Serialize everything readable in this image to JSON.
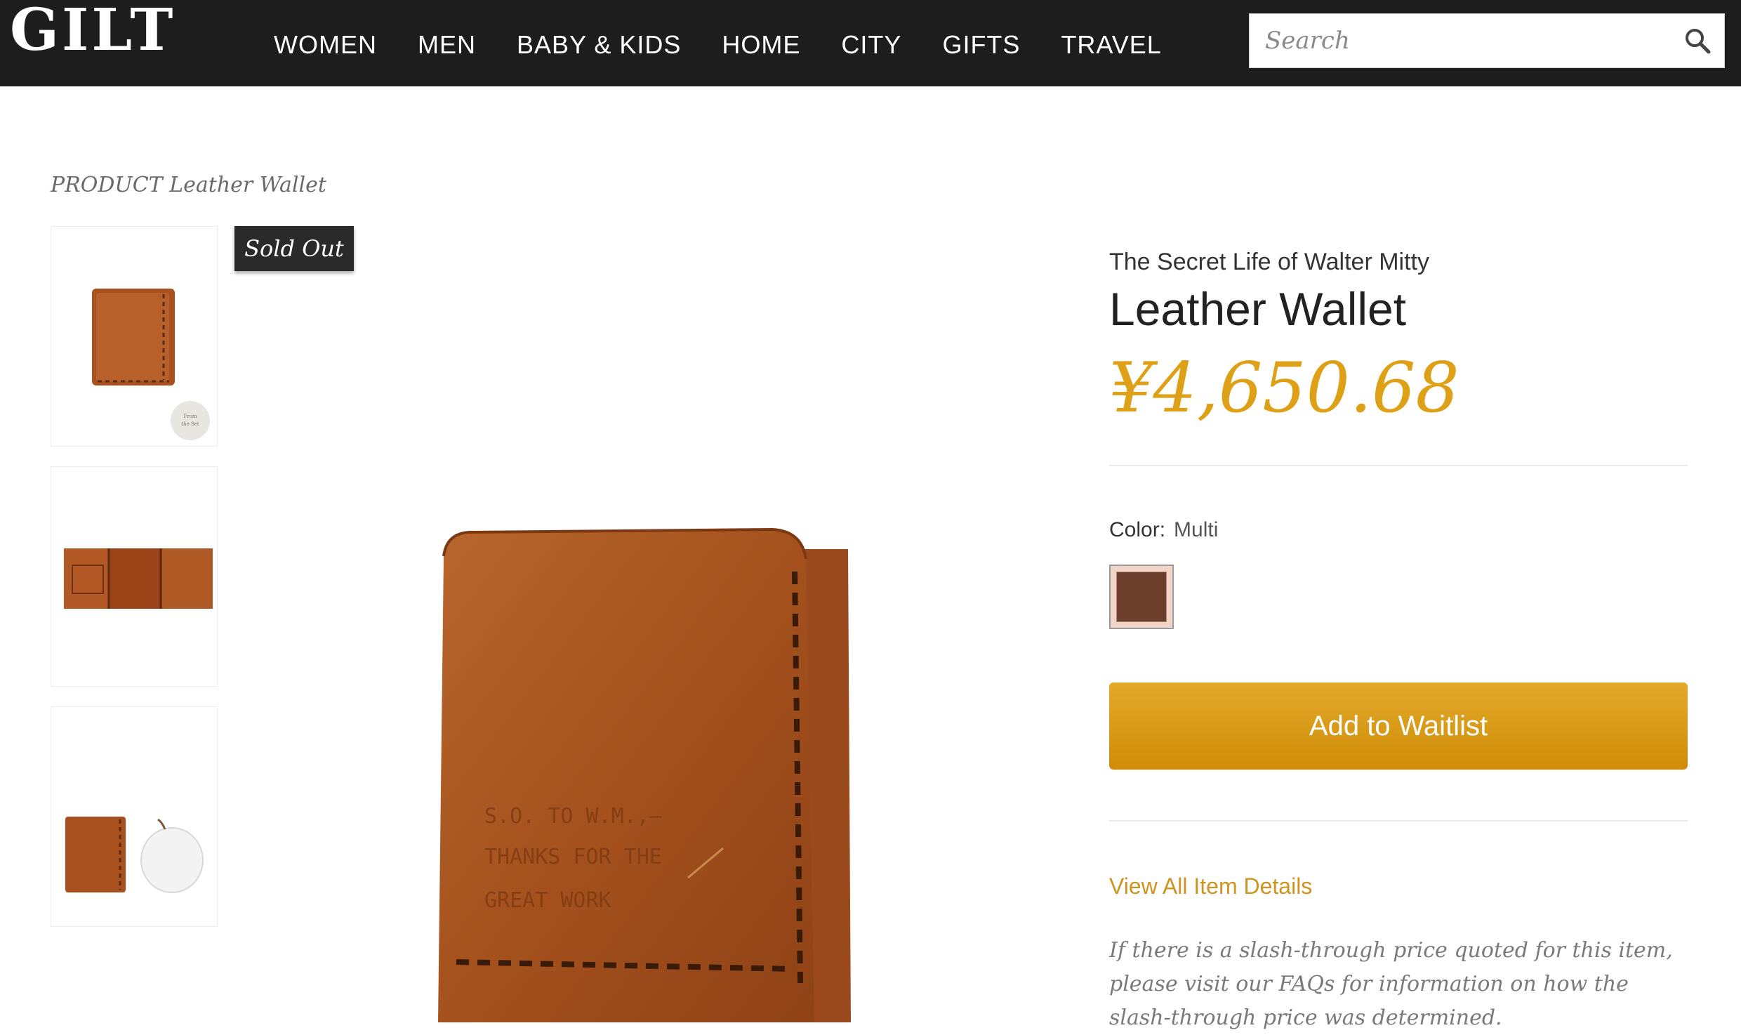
{
  "header": {
    "logo": "GILT",
    "nav": [
      "WOMEN",
      "MEN",
      "BABY & KIDS",
      "HOME",
      "CITY",
      "GIFTS",
      "TRAVEL"
    ],
    "search_placeholder": "Search"
  },
  "breadcrumb": "PRODUCT Leather Wallet",
  "badge": "Sold Out",
  "product": {
    "brand": "The Secret Life of Walter Mitty",
    "name": "Leather Wallet",
    "price": "¥4,650.68",
    "color_label": "Color:",
    "color_value": "Multi",
    "waitlist_label": "Add to Waitlist",
    "details_link": "View All Item Details",
    "note": "If there is a slash-through price quoted for this item, please visit our FAQs for information on how the slash-through price was determined."
  },
  "colors": {
    "header_bg": "#1d1d1d",
    "accent_gold": "#dea017",
    "leather": "#a8511f"
  }
}
